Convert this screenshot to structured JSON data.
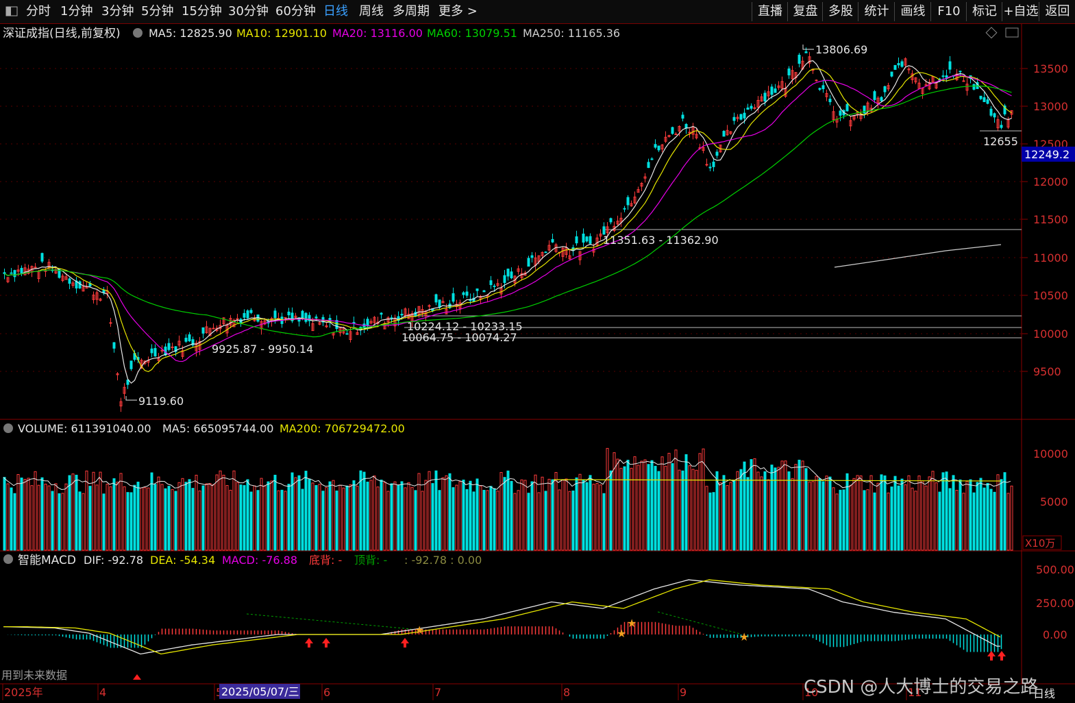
{
  "topbar": {
    "period_tabs": [
      "分时",
      "1分钟",
      "3分钟",
      "5分钟",
      "15分钟",
      "30分钟",
      "60分钟",
      "日线",
      "周线",
      "多周期",
      "更多 >"
    ],
    "active_tab": "日线",
    "right_buttons": [
      "直播",
      "复盘",
      "多股",
      "统计",
      "画线",
      "F10",
      "标记",
      "+自选",
      "返回"
    ]
  },
  "main_panel": {
    "title": "深证成指(日线,前复权)",
    "ma": [
      {
        "label": "MA5: 12825.90",
        "color": "#e8e8e8"
      },
      {
        "label": "MA10: 12901.10",
        "color": "#e6e600"
      },
      {
        "label": "MA20: 13116.00",
        "color": "#e600e6"
      },
      {
        "label": "MA60: 13079.51",
        "color": "#00d000"
      },
      {
        "label": "MA250: 11165.36",
        "color": "#cfcfcf"
      }
    ],
    "price_axis": [
      "13500",
      "13000",
      "12500",
      "12000",
      "11500",
      "11000",
      "10500",
      "10000",
      "9500"
    ],
    "current_price": "12249.2",
    "annotations": {
      "high": "13806.69",
      "low": "9119.60",
      "zone1": "9925.87 - 9950.14",
      "zone2": "10224.12 - 10233.15",
      "zone3": "10064.75 - 10074.27",
      "zone4": "11351.63 - 11362.90",
      "recent_low": "12655"
    }
  },
  "volume_panel": {
    "title": "VOLUME: 611391040.00",
    "ma5": "MA5: 665095744.00",
    "ma200": "MA200: 706729472.00",
    "axis": [
      "10000",
      "5000"
    ],
    "unit": "X10万"
  },
  "macd_panel": {
    "title": "智能MACD",
    "dif": "DIF: -92.78",
    "dea": "DEA: -54.34",
    "macd": "MACD: -76.88",
    "bottom_div": "底背: -",
    "top_div": "顶背: -",
    "extra": ": -92.78 : 0.00",
    "axis": [
      "500.00",
      "250.00",
      "0.00"
    ],
    "future_data_label": "用到未来数据"
  },
  "date_axis": {
    "labels": [
      "2025年",
      "4",
      "5",
      "6",
      "7",
      "8",
      "9",
      "10",
      "11"
    ],
    "cursor_date": "2025/05/07/三",
    "period_label": "日线"
  },
  "watermark": "CSDN @人大博士的交易之路",
  "colors": {
    "up": "#ff3b3b",
    "down": "#00e0e0",
    "ma5": "#e8e8e8",
    "ma10": "#e6e600",
    "ma20": "#e600e6",
    "ma60": "#00d000",
    "grid": "#7a0000"
  }
}
